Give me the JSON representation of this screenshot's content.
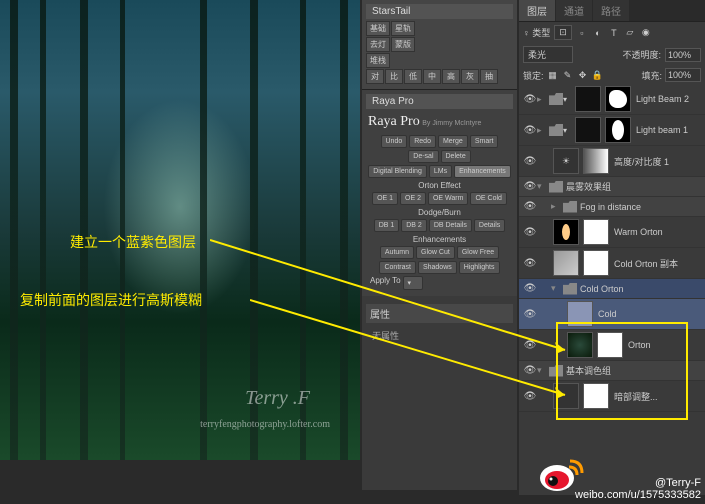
{
  "image": {
    "annotations": {
      "top": "建立一个蓝紫色图层",
      "bottom": "复制前面的图层进行高斯模糊"
    },
    "watermark_name": "Terry .F",
    "watermark_url": "terryfengphotography.lofter.com"
  },
  "starstail": {
    "title": "StarsTail",
    "buttons_r1": [
      "基础",
      "星轨",
      "蒙版"
    ],
    "buttons_r2": [
      "去灯",
      "堆栈"
    ],
    "small_row": [
      "对",
      "比",
      "低",
      "中",
      "高",
      "灰",
      "抽"
    ]
  },
  "raya": {
    "title": "Raya Pro",
    "subtitle": "By Jimmy McIntyre",
    "row1": [
      "Undo",
      "Redo",
      "Merge",
      "Smart",
      "De-sal",
      "Delete"
    ],
    "row2": [
      "Digital Blending",
      "LMs",
      "Enhancements"
    ],
    "section1": "Orton Effect",
    "row3": [
      "OE 1",
      "OE 2",
      "OE Warm",
      "OE Cold"
    ],
    "section2": "Dodge/Burn",
    "row4": [
      "DB 1",
      "DB 2",
      "DB Details",
      "Details"
    ],
    "section3": "Enhancements",
    "row5": [
      "Autumn",
      "Glow Cut",
      "Glow Free"
    ],
    "row6": [
      "Contrast",
      "Shadows",
      "Highlights"
    ],
    "apply": "Apply To"
  },
  "properties": {
    "tab": "属性",
    "body": "无属性"
  },
  "layers_panel": {
    "tabs": [
      "图层",
      "通道",
      "路径"
    ],
    "kind_label": "♀ 类型",
    "blend_mode": "柔光",
    "opacity_label": "不透明度:",
    "opacity_value": "100%",
    "lock_label": "锁定:",
    "fill_label": "填充:",
    "fill_value": "100%",
    "layers": [
      {
        "name": "Light Beam 2",
        "type": "layer",
        "mask": "shape1"
      },
      {
        "name": "Light beam 1",
        "type": "layer",
        "mask": "shape2"
      },
      {
        "name": "高度/对比度 1",
        "type": "adjustment"
      },
      {
        "name": "晨雾效果组",
        "type": "group"
      },
      {
        "name": "Fog in distance",
        "type": "group-nested"
      },
      {
        "name": "Warm Orton",
        "type": "layer",
        "mask": "white"
      },
      {
        "name": "Cold Orton 副本",
        "type": "layer",
        "mask": "white"
      },
      {
        "name": "Cold Orton",
        "type": "group",
        "selected_group": true
      },
      {
        "name": "Cold",
        "type": "layer",
        "selected": true,
        "mask": "none"
      },
      {
        "name": "Orton",
        "type": "layer",
        "mask": "white"
      },
      {
        "name": "基本调色组",
        "type": "group"
      },
      {
        "name": "暗部调整...",
        "type": "layer",
        "mask": "white"
      }
    ]
  },
  "attribution": {
    "line1": "@Terry-F",
    "line2": "weibo.com/u/1575333582"
  }
}
